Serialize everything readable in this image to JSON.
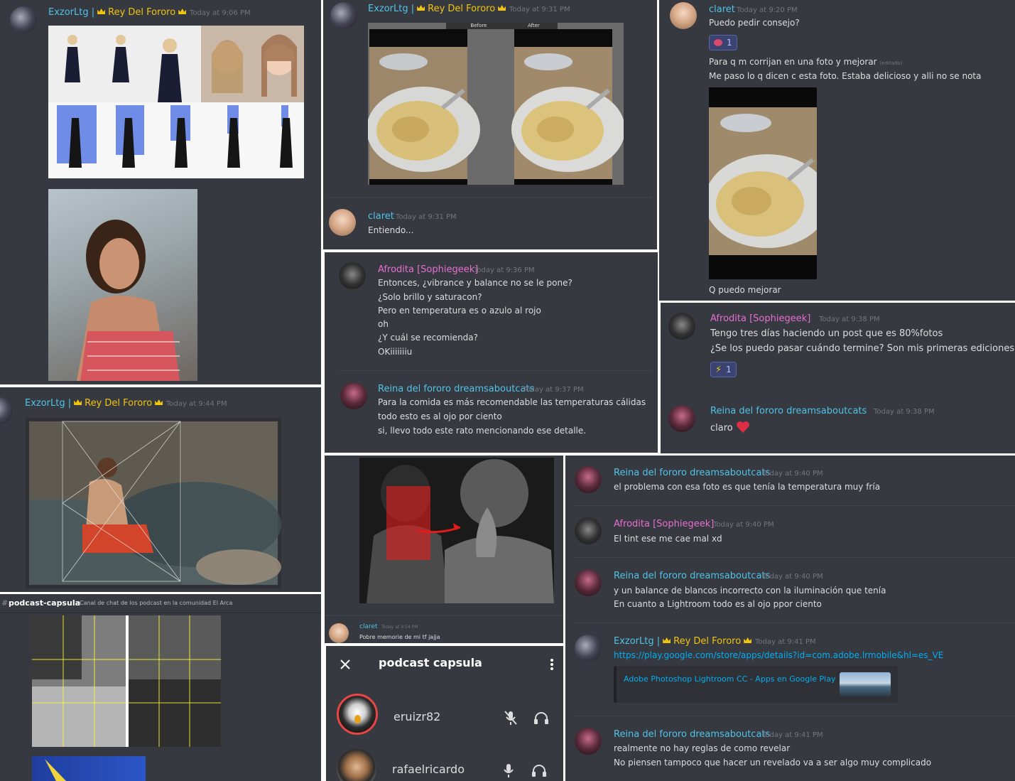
{
  "p1": {
    "user": "ExzorLtg |",
    "role": "Rey Del Fororo",
    "time": "Today at 9:06 PM"
  },
  "p2": {
    "user": "ExzorLtg |",
    "role": "Rey Del Fororo",
    "time": "Today at 9:31 PM",
    "before_label": "Before",
    "after_label": "After",
    "reply_user": "claret",
    "reply_time": "Today at 9:31 PM",
    "reply_text": "Entiendo..."
  },
  "p3": {
    "user": "claret",
    "time": "Today at 9:20 PM",
    "line1": "Puedo pedir consejo?",
    "reaction_count": "1",
    "line2": "Para q m corrijan en una foto y mejorar",
    "edited": "(editado)",
    "line3": "Me paso lo q dicen c esta foto. Estaba delicioso y alli no se nota",
    "line4": "Q puedo mejorar"
  },
  "p4": {
    "user": "Afrodita [Sophiegeek]",
    "time": "Today at 9:36 PM",
    "lines": [
      "Entonces, ¿vibrance y balance no se le pone?",
      "¿Solo brillo y saturacon?",
      "Pero en temperatura es o azulo al rojo",
      "oh",
      "¿Y cuál se recomienda?",
      "OKiiiiiiiu"
    ],
    "user2": "Reina del fororo dreamsaboutcats",
    "time2": "Today at 9:37 PM",
    "lines2": [
      "Para la comida es más recomendable las temperaturas cálidas",
      "todo esto es al ojo por ciento",
      "si, llevo todo este rato mencionando ese detalle."
    ]
  },
  "p5": {
    "user": "Afrodita [Sophiegeek]",
    "time": "Today at 9:38 PM",
    "line1": "Tengo tres días haciendo un post que es 80%fotos",
    "line2": "¿Se los puedo pasar cuándo termine? Son mis primeras ediciones",
    "reaction_count": "1",
    "user2": "Reina del fororo dreamsaboutcats",
    "time2": "Today at 9:38 PM",
    "line3": "claro"
  },
  "p6": {
    "user": "ExzorLtg |",
    "role": "Rey Del Fororo",
    "time": "Today at 9:44 PM"
  },
  "p7": {
    "channel": "podcast-capsula",
    "topic": "Canal de chat de los podcast en la comunidad El Arca"
  },
  "p8": {
    "user": "claret",
    "time": "Today at 9:54 PM",
    "text": "Pobre memorie de mi tf jajja"
  },
  "p9": {
    "title": "podcast capsula",
    "members": [
      {
        "name": "eruizr82"
      },
      {
        "name": "rafaelricardo"
      }
    ]
  },
  "p10": {
    "msgs": [
      {
        "user": "Reina del fororo dreamsaboutcats",
        "time": "Today at 9:40 PM",
        "lines": [
          "el problema con esa foto es que tenía la temperatura muy fría"
        ]
      },
      {
        "user": "Afrodita [Sophiegeek]",
        "time": "Today at 9:40 PM",
        "lines": [
          "El tint ese me cae mal xd"
        ]
      },
      {
        "user": "Reina del fororo dreamsaboutcats",
        "time": "Today at 9:40 PM",
        "lines": [
          "y un balance de blancos incorrecto con la iluminación que tenía",
          "En cuanto a Lightroom todo es al ojo ppor ciento"
        ]
      },
      {
        "user": "ExzorLtg |",
        "role": "Rey Del Fororo",
        "time": "Today at 9:41 PM",
        "link": "https://play.google.com/store/apps/details?id=com.adobe.lrmobile&hl=es_VE",
        "embed_title": "Adobe Photoshop Lightroom CC - Apps en Google Play"
      },
      {
        "user": "Reina del fororo dreamsaboutcats",
        "time": "Today at 9:41 PM",
        "lines": [
          "realmente no hay reglas de como revelar",
          "No piensen tampoco que hacer un revelado va a ser algo muy complicado"
        ]
      }
    ]
  },
  "colors": {
    "bg": "#36393f",
    "cyan": "#4fc3e8",
    "pink": "#e66fd1",
    "gold": "#f1c40f",
    "muted": "#72767d"
  }
}
